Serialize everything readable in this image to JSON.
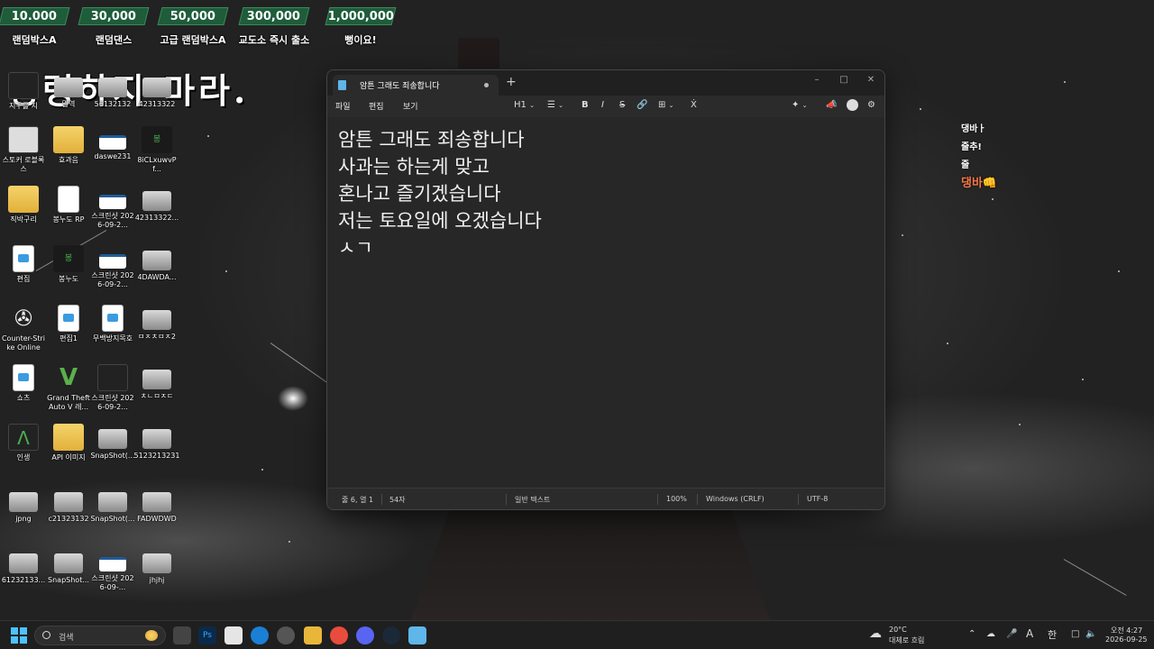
{
  "donations": [
    {
      "amount": "10.000",
      "label": "랜덤박스A"
    },
    {
      "amount": "30,000",
      "label": "랜덤댄스"
    },
    {
      "amount": "50,000",
      "label": "고급 랜덤박스A"
    },
    {
      "amount": "300,000",
      "label": "교도소 즉시 출소"
    },
    {
      "amount": "1,000,000",
      "label": "뻥이요!"
    }
  ],
  "overlay_title": "명령하지 마라.",
  "desktop_icons": [
    {
      "label": "지구를 지"
    },
    {
      "label": "밀역"
    },
    {
      "label": "56132132"
    },
    {
      "label": "42313322"
    },
    {
      "label": "스토커 로블록스"
    },
    {
      "label": "효과음"
    },
    {
      "label": "daswe231"
    },
    {
      "label": "8iCLxuwvPf..."
    },
    {
      "label": "직박구리"
    },
    {
      "label": "봉누도 RP"
    },
    {
      "label": "스크린샷 2026-09-2..."
    },
    {
      "label": "42313322..."
    },
    {
      "label": "편집"
    },
    {
      "label": "봉누도"
    },
    {
      "label": "스크린샷 2026-09-2..."
    },
    {
      "label": "4DAWDA..."
    },
    {
      "label": "Counter-Strike Online"
    },
    {
      "label": "편집1"
    },
    {
      "label": "무백방지목호"
    },
    {
      "label": "ㅁㅈㅊㅁㅈ2"
    },
    {
      "label": "쇼츠"
    },
    {
      "label": "Grand Theft Auto V 레..."
    },
    {
      "label": "스크린샷 2026-09-2..."
    },
    {
      "label": "ㅊㄴㅁㅈㄷ"
    },
    {
      "label": "인생"
    },
    {
      "label": "API 이미지"
    },
    {
      "label": "SnapShot(..."
    },
    {
      "label": "5123213231"
    },
    {
      "label": "jpng"
    },
    {
      "label": "c21323132"
    },
    {
      "label": "SnapShot(..."
    },
    {
      "label": "FADWDWD"
    },
    {
      "label": "61232133..."
    },
    {
      "label": "SnapShot..."
    },
    {
      "label": "스크린샷 2026-09-..."
    },
    {
      "label": "jhjhj"
    }
  ],
  "notepad": {
    "tab_title": "암튼 그래도 죄송합니다",
    "new_tab": "+",
    "menus": [
      "파일",
      "편집",
      "보기"
    ],
    "heading_tool": "H1",
    "bold_tool": "B",
    "italic_tool": "I",
    "strike_tool": "S",
    "lines": [
      "암튼 그래도 죄송합니다",
      "사과는 하는게 맞고",
      "혼나고 즐기겠습니다",
      "저는 토요일에 오겠습니다",
      "ㅅㄱ"
    ],
    "status": {
      "position": "줄 6, 열 1",
      "chars": "54자",
      "format": "일반 텍스트",
      "zoom": "100%",
      "line_ending": "Windows (CRLF)",
      "encoding": "UTF-8"
    }
  },
  "chat": [
    {
      "text": "댕바ㅏ"
    },
    {
      "text": "줄추!"
    },
    {
      "text": "줄"
    },
    {
      "text": "댕바👊"
    }
  ],
  "taskbar": {
    "search_placeholder": "검색",
    "weather_temp": "20°C",
    "weather_desc": "대체로 흐림",
    "ime_a": "A",
    "ime_han": "한",
    "time": "오전 4:27",
    "date": "2026-09-25"
  },
  "colors": {
    "accent": "#4cc2ff",
    "donate_bg": "#1e5c3a",
    "chat_accent": "#f4774a"
  }
}
